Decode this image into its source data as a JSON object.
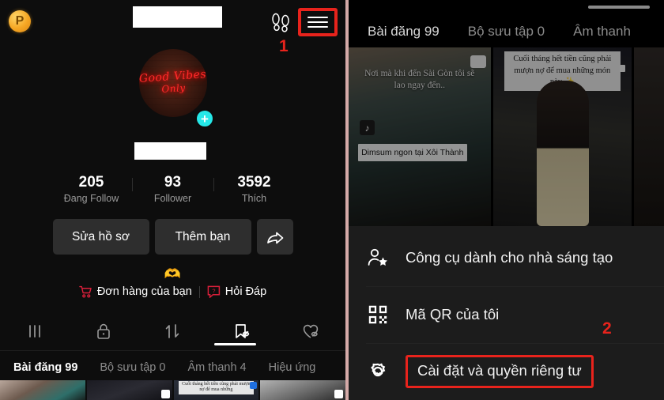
{
  "left_panel": {
    "coin_icon": "points-coin-icon",
    "coin_label": "P",
    "username_redacted": "",
    "footprint_icon": "footprint-icon",
    "menu_icon": "hamburger-menu-icon",
    "step_marker_1": "1",
    "avatar": {
      "icon": "profile-avatar",
      "neon_line1": "Good Vibes",
      "neon_line2": "Only",
      "add_badge": "+"
    },
    "handle_redacted": "",
    "stats": [
      {
        "num": "205",
        "label": "Đang Follow"
      },
      {
        "num": "93",
        "label": "Follower"
      },
      {
        "num": "3592",
        "label": "Thích"
      }
    ],
    "actions": [
      {
        "label": "Sửa hồ sơ",
        "icon": "edit-profile-button"
      },
      {
        "label": "Thêm bạn",
        "icon": "add-friend-button"
      },
      {
        "label": "",
        "icon": "share-arrow-icon"
      }
    ],
    "hearts_emoji": "🫶",
    "shop_links": [
      {
        "label": "Đơn hàng của bạn",
        "icon": "shopping-cart-icon"
      },
      {
        "label": "Hỏi Đáp",
        "icon": "question-answer-icon"
      }
    ],
    "content_tabs": [
      {
        "icon": "grid-posts-icon",
        "active": false
      },
      {
        "icon": "lock-private-icon",
        "active": false
      },
      {
        "icon": "repost-icon",
        "active": false
      },
      {
        "icon": "saved-bookmark-hidden-icon",
        "active": true
      },
      {
        "icon": "liked-heart-hidden-icon",
        "active": false
      }
    ],
    "sub_tabs": [
      {
        "label": "Bài đăng 99",
        "active": true
      },
      {
        "label": "Bộ sưu tập 0",
        "active": false
      },
      {
        "label": "Âm thanh 4",
        "active": false
      },
      {
        "label": "Hiệu ứng",
        "active": false
      }
    ],
    "thumb_caption": "Cuối tháng hết tiền cũng phải mượn nợ để mua những"
  },
  "right_panel": {
    "drawer_handle": "drawer-handle",
    "tabs": [
      {
        "label": "Bài đăng 99",
        "active": true
      },
      {
        "label": "Bộ sưu tập 0",
        "active": false
      },
      {
        "label": "Âm thanh",
        "active": false
      }
    ],
    "thumbnails": [
      {
        "caption_top": "Nơi mà khi đến Sài Gòn tôi sẽ lao ngay đến..",
        "caption_pill": "Dimsum ngon tại Xôi Thành",
        "watermark": "TikTok"
      },
      {
        "caption_top": "Cuối tháng hết tiền cũng phải mượn nợ để mua những món này ✨"
      },
      {
        "caption_top": ""
      }
    ],
    "menu_items": [
      {
        "label": "Công cụ dành cho nhà sáng tạo",
        "icon": "creator-tools-icon",
        "highlighted": false
      },
      {
        "label": "Mã QR của tôi",
        "icon": "qr-code-icon",
        "highlighted": false
      },
      {
        "label": "Cài đặt và quyền riêng tư",
        "icon": "settings-gear-icon",
        "highlighted": true
      }
    ],
    "step_marker_2": "2"
  },
  "colors": {
    "highlight_red": "#e8231c",
    "accent_cyan": "#25e8e8",
    "coin_gold": "#f5a623",
    "shop_red": "#d81f3a",
    "divider_pink": "#d5aaa8"
  }
}
